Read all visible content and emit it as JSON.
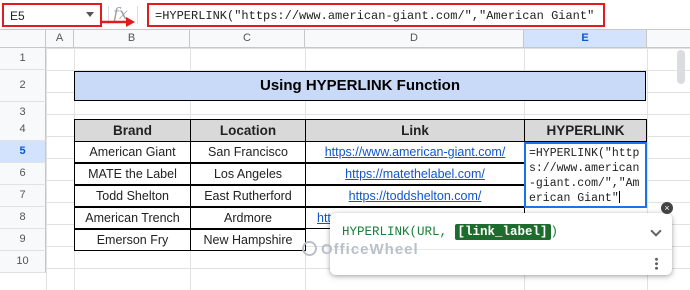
{
  "formula_bar": {
    "cell_ref": "E5",
    "fx": "fx",
    "formula": "=HYPERLINK(\"https://www.american-giant.com/\",\"American Giant\""
  },
  "columns": [
    "A",
    "B",
    "C",
    "D",
    "E"
  ],
  "rows": [
    "1",
    "2",
    "3",
    "4",
    "5",
    "6",
    "7",
    "8",
    "9",
    "10"
  ],
  "sheet": {
    "title": "Using HYPERLINK Function",
    "headers": [
      "Brand",
      "Location",
      "Link",
      "HYPERLINK"
    ],
    "data": [
      {
        "brand": "American Giant",
        "location": "San Francisco",
        "link": "https://www.american-giant.com/"
      },
      {
        "brand": "MATE the Label",
        "location": "Los Angeles",
        "link": "https://matethelabel.com/"
      },
      {
        "brand": "Todd Shelton",
        "location": "East Rutherford",
        "link": "https://toddshelton.com/"
      },
      {
        "brand": "American Trench",
        "location": "Ardmore",
        "link": "htt"
      },
      {
        "brand": "Emerson Fry",
        "location": "New Hampshire",
        "link": ""
      }
    ],
    "edit_text": "=HYPERLINK(\"https://www.american-giant.com/\",\"American Giant\""
  },
  "tooltip": {
    "syntax_prefix": "HYPERLINK(URL, ",
    "syntax_active_arg": "[link_label]",
    "syntax_suffix": ")",
    "close": "×"
  },
  "watermark": "OfficeWheel",
  "colors": {
    "title_bg": "#c9daf8",
    "header_bg": "#d9d9d9",
    "highlight_border": "#e11c1c",
    "link": "#1155cc",
    "active_cell_border": "#1a73e8",
    "tooltip_text": "#188038"
  }
}
